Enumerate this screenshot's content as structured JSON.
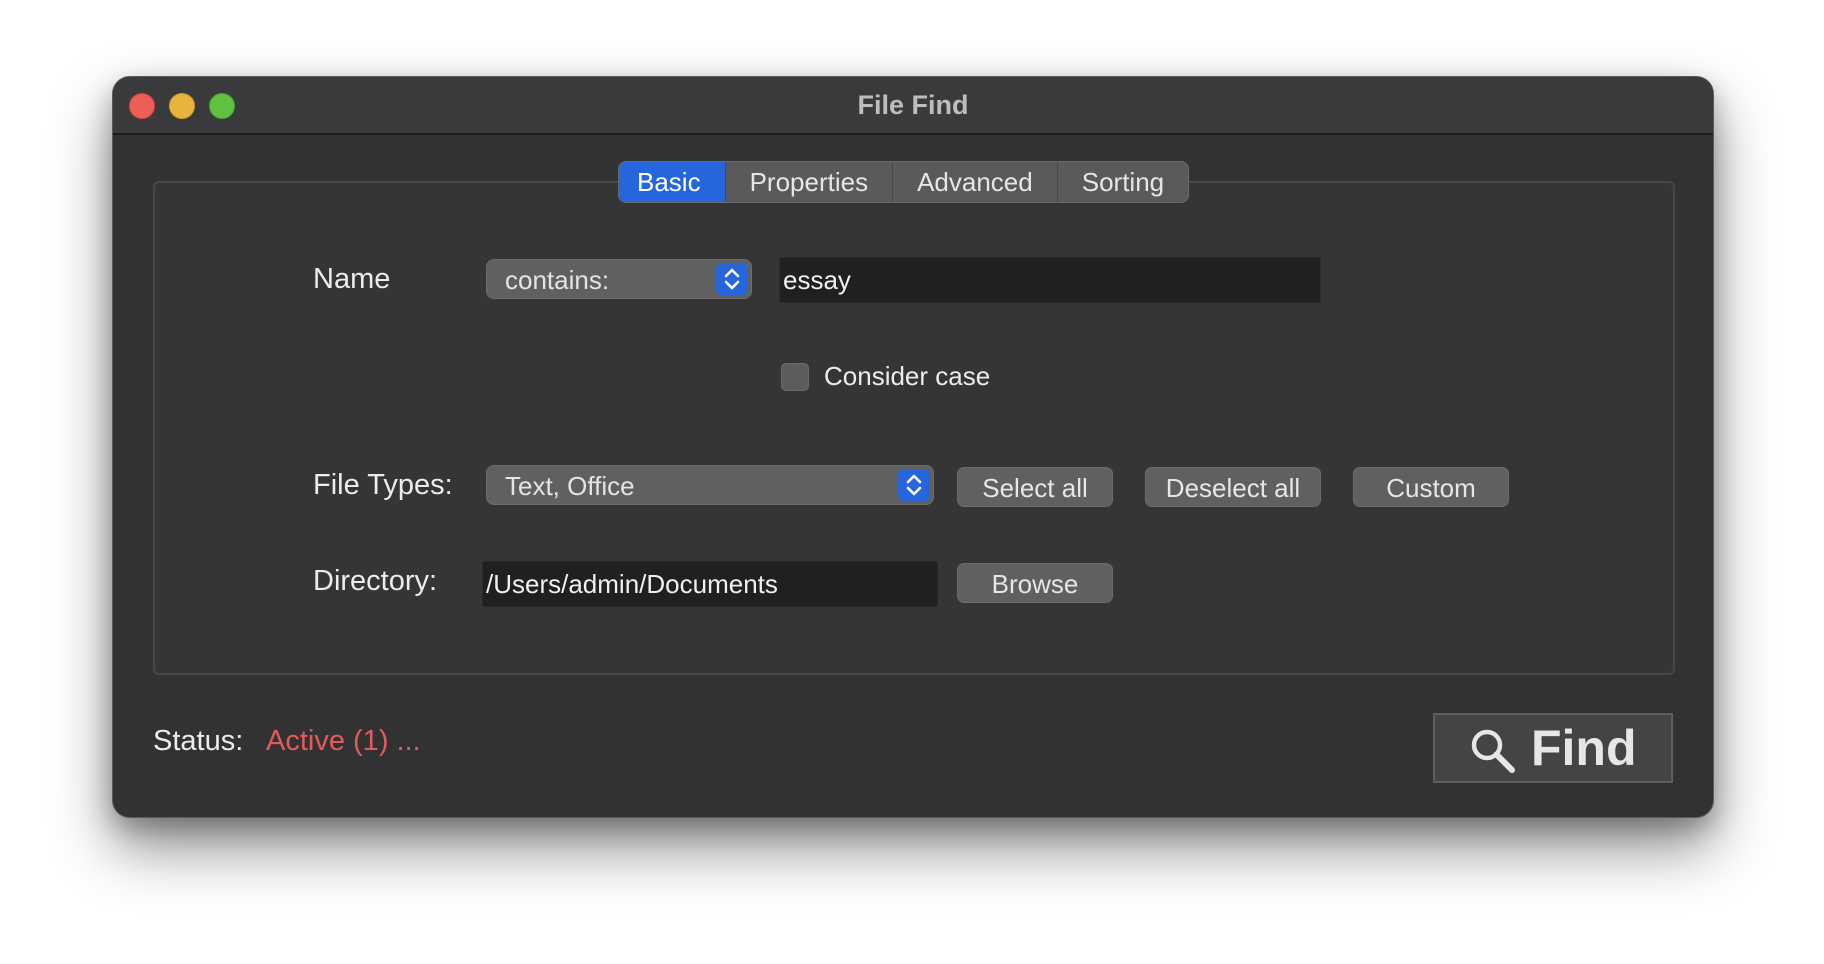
{
  "window": {
    "title": "File Find",
    "controls": [
      "close",
      "minimize",
      "zoom"
    ]
  },
  "tabs": [
    {
      "label": "Basic",
      "active": true
    },
    {
      "label": "Properties",
      "active": false
    },
    {
      "label": "Advanced",
      "active": false
    },
    {
      "label": "Sorting",
      "active": false
    }
  ],
  "basic": {
    "name_label": "Name",
    "name_match": "contains:",
    "name_value": "essay",
    "consider_case_label": "Consider case",
    "consider_case_checked": false,
    "file_types_label": "File Types:",
    "file_types_value": "Text, Office",
    "select_all_label": "Select all",
    "deselect_all_label": "Deselect all",
    "custom_label": "Custom",
    "directory_label": "Directory:",
    "directory_value": "/Users/admin/Documents",
    "browse_label": "Browse"
  },
  "status": {
    "label": "Status:",
    "value": "Active (1) ...",
    "value_color": "#e25a5a"
  },
  "find_button": {
    "label": "Find",
    "icon": "magnifier-icon"
  },
  "colors": {
    "accent": "#2566dd",
    "window_bg": "#323232"
  }
}
